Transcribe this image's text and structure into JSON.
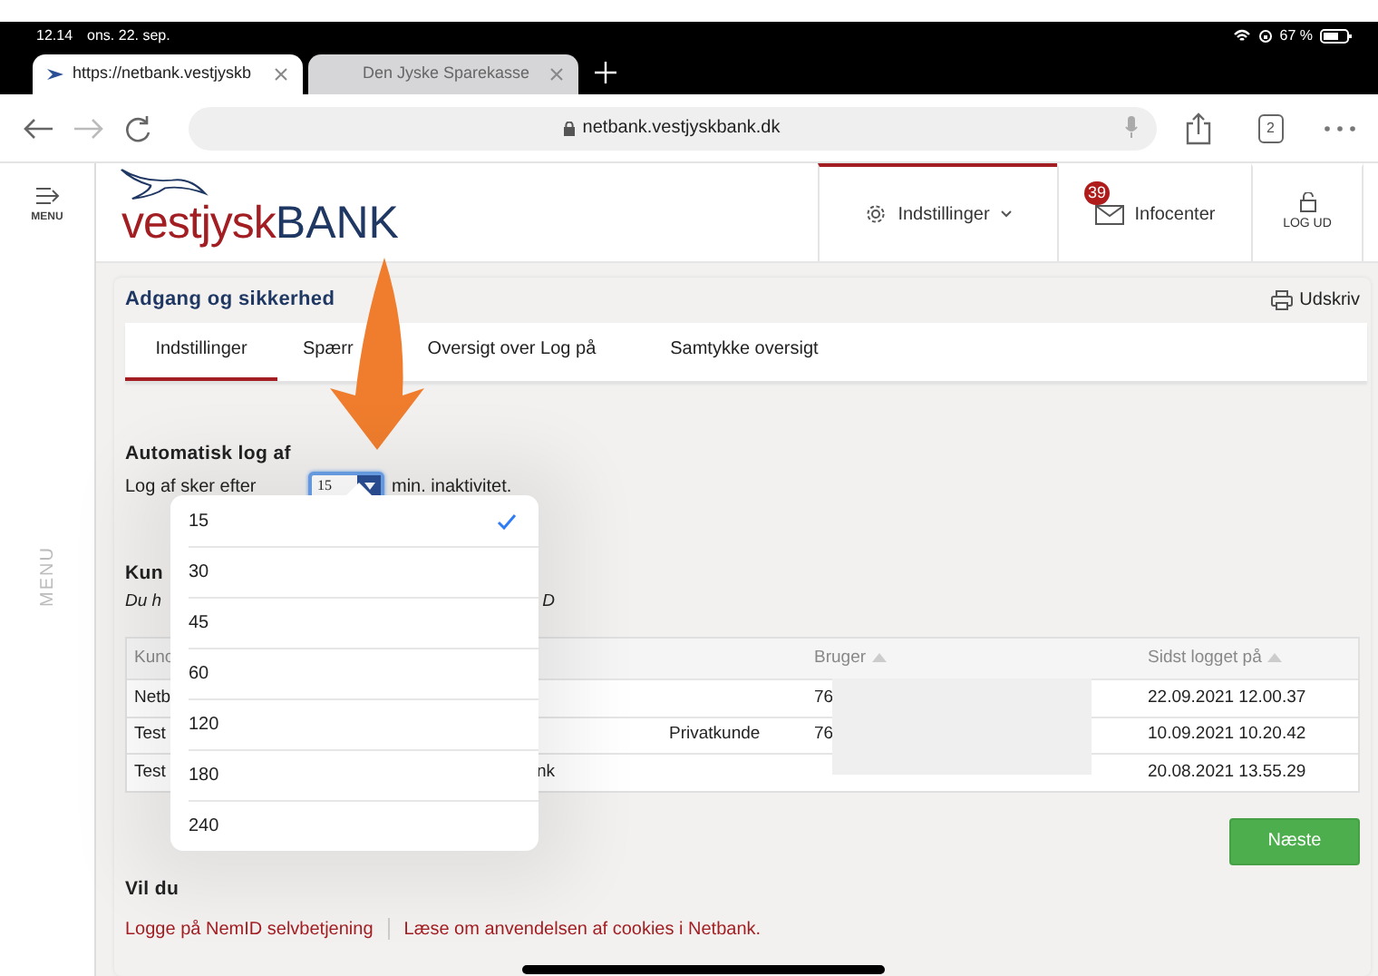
{
  "status_bar": {
    "time": "12.14",
    "date": "ons. 22. sep.",
    "battery": "67 %"
  },
  "browser": {
    "tabs": [
      {
        "title": "https://netbank.vestjyskb",
        "selected": true
      },
      {
        "title": "Den Jyske Sparekasse",
        "selected": false
      }
    ],
    "address": "netbank.vestjyskbank.dk",
    "tab_count": "2"
  },
  "app_header": {
    "menu_label": "MENU",
    "logo": {
      "part_1": "vestjysk",
      "part_2": "BANK"
    },
    "nav": [
      {
        "kind": "settings",
        "label": "Indstillinger",
        "selected": true
      },
      {
        "kind": "inbox",
        "label": "Infocenter",
        "badge": "39",
        "selected": false
      },
      {
        "kind": "logout",
        "label": "LOG UD",
        "selected": false
      }
    ]
  },
  "side_label": "MENU",
  "card": {
    "title": "Adgang og sikkerhed",
    "print": "Udskriv",
    "tabs": [
      {
        "label": "Indstillinger",
        "selected": true
      },
      {
        "label": "Spærr",
        "selected": false
      },
      {
        "label": "Oversigt over Log på",
        "selected": false
      },
      {
        "label": "Samtykke oversigt",
        "selected": false
      }
    ],
    "auto_logout": {
      "heading": "Automatisk log af",
      "label": "Log af sker efter",
      "value": "15",
      "suffix": "min. inaktivitet."
    },
    "dropdown": {
      "options": [
        {
          "label": "15",
          "selected": true
        },
        {
          "label": "30",
          "selected": false
        },
        {
          "label": "45",
          "selected": false
        },
        {
          "label": "60",
          "selected": false
        },
        {
          "label": "120",
          "selected": false
        },
        {
          "label": "180",
          "selected": false
        },
        {
          "label": "240",
          "selected": false
        }
      ]
    },
    "customers": {
      "heading": "Kun",
      "note": "Du h",
      "note_end": "D"
    },
    "table": {
      "header": {
        "column_1": "Kunc",
        "bruger": "Bruger",
        "sidst_logget_paa": "Sidst logget på"
      },
      "rows": [
        {
          "column_1": "Netb",
          "bruger": "76",
          "sidst_logget_paa": "22.09.2021 12.00.37"
        },
        {
          "column_1": "Test",
          "column_3": "Privatkunde",
          "bruger": "76",
          "sidst_logget_paa": "10.09.2021 10.20.42"
        },
        {
          "column_1": "Test",
          "column_2": "nk",
          "sidst_logget_paa": "20.08.2021 13.55.29"
        }
      ]
    },
    "next_button": "Næste",
    "more": {
      "heading": "Vil du",
      "links": [
        "Logge på NemID selvbetjening",
        "Læse om anvendelsen af cookies i Netbank."
      ]
    }
  }
}
